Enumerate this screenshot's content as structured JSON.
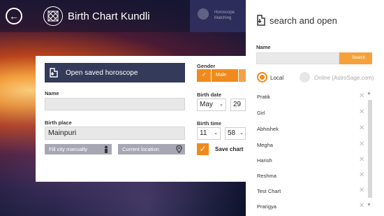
{
  "header": {
    "title": "Birth Chart Kundli",
    "tile_label": "Horoscope Matching"
  },
  "form": {
    "open_saved_label": "Open saved horoscope",
    "name_label": "Name",
    "name_value": "",
    "birth_place_label": "Birth place",
    "birth_place_value": "Mainpuri",
    "fill_city_label": "Fill city manually",
    "current_location_label": "Current location",
    "gender_label": "Gender",
    "gender_value": "Male",
    "birth_date_label": "Birth date",
    "birth_month": "May",
    "birth_day": "29",
    "birth_time_label": "Birth time",
    "birth_hour": "11",
    "birth_minute": "58",
    "save_chart_label": "Save chart"
  },
  "panel": {
    "title": "search and open",
    "name_label": "Name",
    "search_placeholder": "",
    "search_button": "Search",
    "radio_local": "Local",
    "radio_online": "Online (AstroSage.com)",
    "selected_source": "Local",
    "items": [
      {
        "label": "Pratik"
      },
      {
        "label": "Girl"
      },
      {
        "label": "Abhishek"
      },
      {
        "label": "Megha"
      },
      {
        "label": "Harish"
      },
      {
        "label": "Reshma"
      },
      {
        "label": "Test Chart"
      },
      {
        "label": "Prarigya"
      }
    ]
  },
  "colors": {
    "accent": "#f08a1c",
    "dark_button": "#343a5a"
  }
}
